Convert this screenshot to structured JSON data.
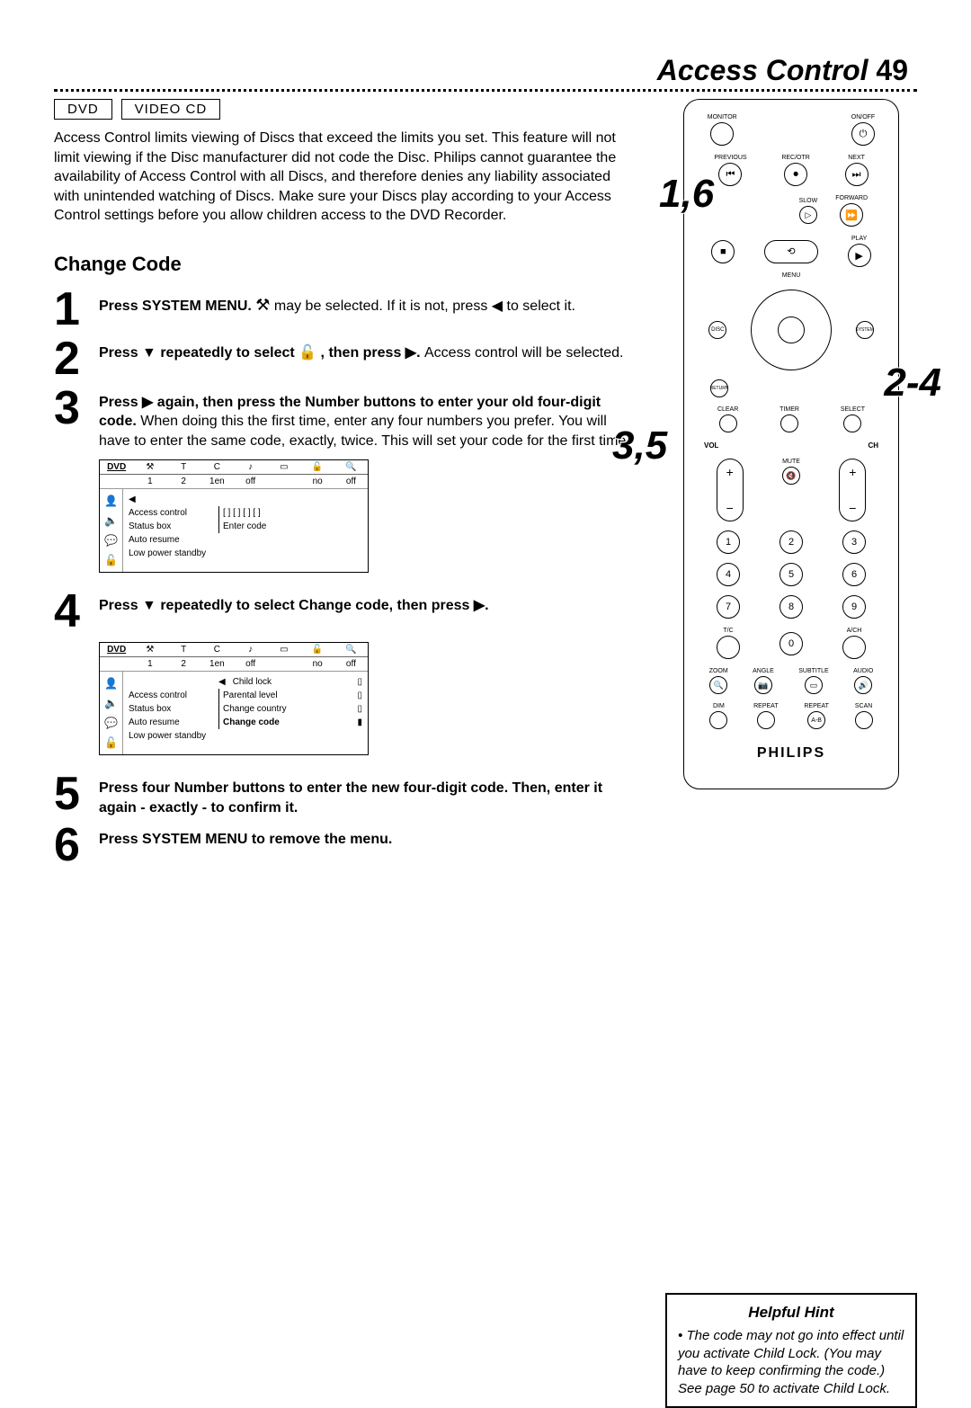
{
  "header": {
    "title": "Access Control",
    "page_number": "49"
  },
  "tags": {
    "dvd": "DVD",
    "vcd": "VIDEO CD"
  },
  "intro": "Access Control limits viewing of Discs that exceed the limits you set. This feature will not limit viewing if the Disc manufacturer did not code the Disc. Philips cannot guarantee the availability of Access Control with all Discs, and therefore denies any liability associated with unintended watching of Discs. Make sure your Discs play according to your Access Control settings before you allow children access to the DVD Recorder.",
  "section_title": "Change Code",
  "steps": {
    "s1": {
      "n": "1",
      "bold": "Press SYSTEM MENU.",
      "rest_a": " ",
      "rest_b": " may be selected. If it is not, press ◀ to select it."
    },
    "s2": {
      "n": "2",
      "bold": "Press ▼ repeatedly to select ",
      "bold_tail": ", then press ▶.",
      "rest": " Access control will be selected."
    },
    "s3": {
      "n": "3",
      "bold": "Press ▶ again, then press the Number buttons to enter your old four-digit code.",
      "rest": " When doing this the first time, enter any four numbers you prefer. You will have to enter the same code, exactly, twice. This will set your code for the first time."
    },
    "s4": {
      "n": "4",
      "bold": "Press ▼ repeatedly to select Change code, then press ▶."
    },
    "s5": {
      "n": "5",
      "bold": "Press four Number buttons to enter the new four-digit code. Then, enter it again - exactly - to confirm it."
    },
    "s6": {
      "n": "6",
      "bold": "Press SYSTEM MENU to remove the menu."
    }
  },
  "menu1": {
    "head": [
      "",
      "T",
      "C",
      "",
      "",
      "",
      "",
      ""
    ],
    "vals": [
      "",
      "1",
      "2",
      "1en",
      "off",
      "",
      "no",
      "off"
    ],
    "rows": [
      {
        "lab": "Access control",
        "sel": "[ ]  [ ]  [ ]  [ ]"
      },
      {
        "lab": "Status box",
        "sel": "Enter code"
      },
      {
        "lab": "Auto resume",
        "sel": ""
      },
      {
        "lab": "Low power standby",
        "sel": ""
      }
    ],
    "arrow": "◀"
  },
  "menu2": {
    "head": [
      "",
      "T",
      "C",
      "",
      "",
      "",
      "",
      ""
    ],
    "vals": [
      "",
      "1",
      "2",
      "1en",
      "off",
      "",
      "no",
      "off"
    ],
    "rows": [
      {
        "lab": "",
        "sel": "Child lock",
        "bar": true
      },
      {
        "lab": "Access control",
        "sel": "Parental level",
        "bar": true
      },
      {
        "lab": "Status box",
        "sel": "Change country",
        "bar": true
      },
      {
        "lab": "Auto resume",
        "sel_bold": "Change code",
        "bar": true,
        "highlight": true
      },
      {
        "lab": "Low power standby",
        "sel": ""
      }
    ],
    "arrow": "◀"
  },
  "callouts": {
    "c1": "1,6",
    "c2": "2-4",
    "c3": "3,5"
  },
  "remote": {
    "labels": {
      "monitor": "MONITOR",
      "onoff": "ON/OFF",
      "previous": "PREVIOUS",
      "recotr": "REC/OTR",
      "next": "NEXT",
      "slow": "SLOW",
      "forward": "FORWARD",
      "play": "PLAY",
      "menu": "MENU",
      "disc": "DISC",
      "system": "SYSTEM",
      "return": "RETURN",
      "clear": "CLEAR",
      "timer": "TIMER",
      "select": "SELECT",
      "vol": "VOL",
      "ch": "CH",
      "mute": "MUTE",
      "tc": "T/C",
      "ach": "A/CH",
      "zoom": "ZOOM",
      "angle": "ANGLE",
      "subtitle": "SUBTITLE",
      "audio": "AUDIO",
      "dim": "DIM",
      "repeat": "REPEAT",
      "repeat2": "REPEAT",
      "scan": "SCAN",
      "ab": "A-B"
    },
    "numbers": [
      "1",
      "2",
      "3",
      "4",
      "5",
      "6",
      "7",
      "8",
      "9",
      "0"
    ],
    "brand": "PHILIPS"
  },
  "hint": {
    "title": "Helpful Hint",
    "bullet": "•",
    "body": "The code may not go into effect until you activate Child Lock. (You may have to keep confirming the code.) See page 50 to activate Child Lock."
  }
}
